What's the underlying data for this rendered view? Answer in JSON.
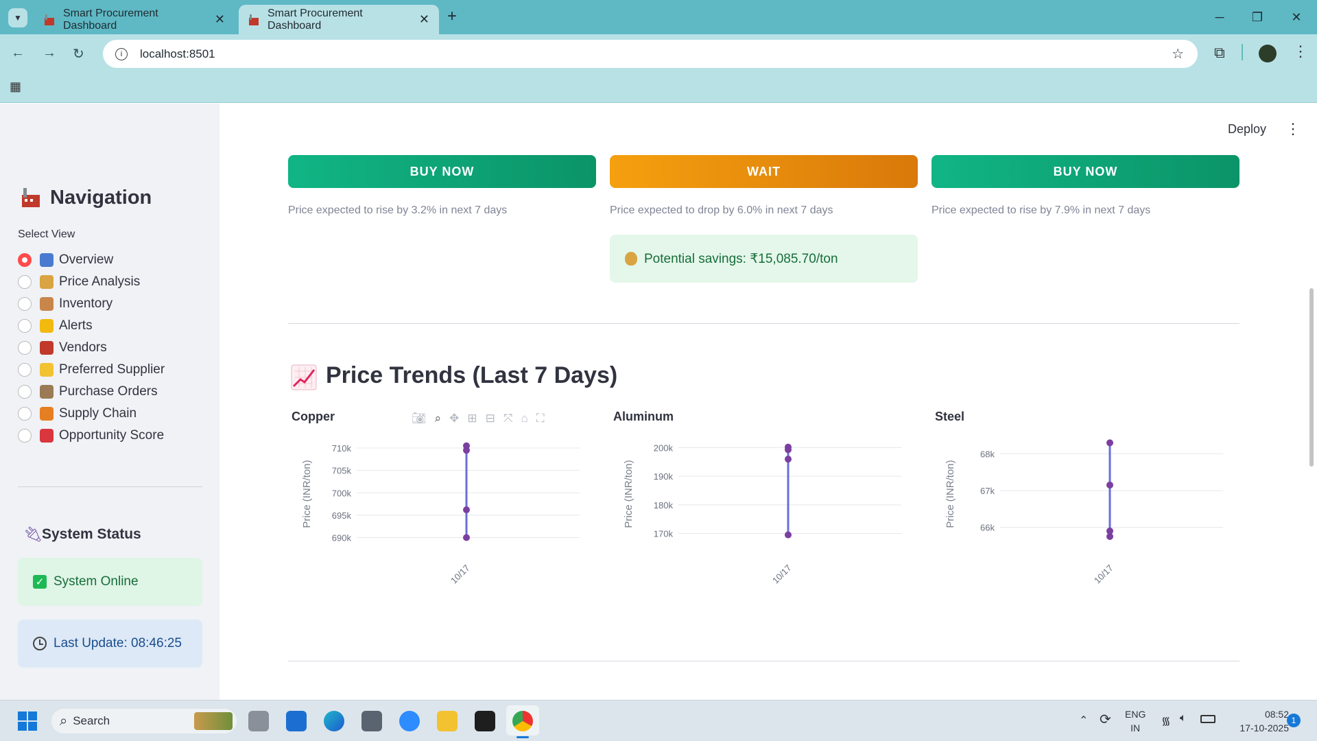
{
  "browser": {
    "tabs": [
      {
        "label": "Smart Procurement Dashboard"
      },
      {
        "label": "Smart Procurement Dashboard"
      }
    ],
    "url": "localhost:8501"
  },
  "app": {
    "deploy_label": "Deploy"
  },
  "sidebar": {
    "title": "Navigation",
    "select_label": "Select View",
    "items": [
      {
        "label": "Overview",
        "selected": true,
        "icon": "chart-icon"
      },
      {
        "label": "Price Analysis",
        "selected": false,
        "icon": "money-bag-icon"
      },
      {
        "label": "Inventory",
        "selected": false,
        "icon": "package-icon"
      },
      {
        "label": "Alerts",
        "selected": false,
        "icon": "bell-icon"
      },
      {
        "label": "Vendors",
        "selected": false,
        "icon": "calendar-icon"
      },
      {
        "label": "Preferred Supplier",
        "selected": false,
        "icon": "handshake-icon"
      },
      {
        "label": "Purchase Orders",
        "selected": false,
        "icon": "clipboard-icon"
      },
      {
        "label": "Supply Chain",
        "selected": false,
        "icon": "truck-icon"
      },
      {
        "label": "Opportunity Score",
        "selected": false,
        "icon": "target-icon"
      }
    ],
    "status_title": "System Status",
    "status_online": "System Online",
    "last_update": "Last Update: 08:46:25"
  },
  "recommendations": [
    {
      "action": "BUY NOW",
      "hint": "Price expected to rise by 3.2% in next 7 days",
      "color": "#10a878"
    },
    {
      "action": "WAIT",
      "hint": "Price expected to drop by 6.0% in next 7 days",
      "color": "#e78a0b",
      "savings": "Potential savings: ₹15,085.70/ton"
    },
    {
      "action": "BUY NOW",
      "hint": "Price expected to rise by 7.9% in next 7 days",
      "color": "#10a878"
    }
  ],
  "section_title": "Price Trends (Last 7 Days)",
  "chart_data": [
    {
      "type": "line",
      "title": "Copper",
      "ylabel": "Price (INR/ton)",
      "x": [
        "10/17",
        "10/17",
        "10/17",
        "10/17"
      ],
      "values": [
        710500,
        709500,
        696200,
        690000
      ],
      "yticks": [
        "710k",
        "705k",
        "700k",
        "695k",
        "690k"
      ],
      "ylim": [
        689000,
        712000
      ],
      "xtick": "10/17"
    },
    {
      "type": "line",
      "title": "Aluminum",
      "ylabel": "Price (INR/ton)",
      "x": [
        "10/17",
        "10/17",
        "10/17",
        "10/17"
      ],
      "values": [
        200200,
        199300,
        196000,
        169500
      ],
      "yticks": [
        "200k",
        "190k",
        "180k",
        "170k"
      ],
      "ylim": [
        167000,
        203000
      ],
      "xtick": "10/17"
    },
    {
      "type": "line",
      "title": "Steel",
      "ylabel": "Price (INR/ton)",
      "x": [
        "10/17",
        "10/17",
        "10/17",
        "10/17"
      ],
      "values": [
        68300,
        67150,
        65900,
        65750
      ],
      "yticks": [
        "68k",
        "67k",
        "66k"
      ],
      "ylim": [
        65600,
        68400
      ],
      "xtick": "10/17"
    }
  ],
  "taskbar": {
    "search_label": "Search",
    "lang": "ENG",
    "region": "IN",
    "time": "08:52",
    "date": "17-10-2025",
    "notif_count": "1"
  }
}
